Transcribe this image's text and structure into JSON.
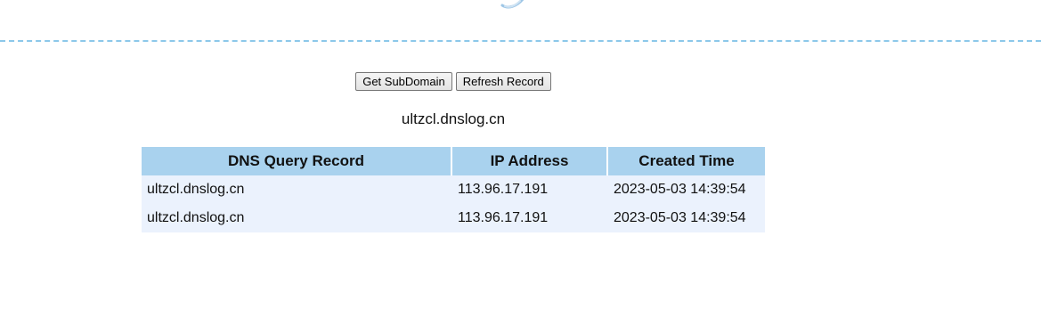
{
  "buttons": {
    "get_subdomain": "Get SubDomain",
    "refresh_record": "Refresh Record"
  },
  "subdomain": "ultzcl.dnslog.cn",
  "table": {
    "headers": [
      "DNS Query Record",
      "IP Address",
      "Created Time"
    ],
    "rows": [
      [
        "ultzcl.dnslog.cn",
        "113.96.17.191",
        "2023-05-03 14:39:54"
      ],
      [
        "ultzcl.dnslog.cn",
        "113.96.17.191",
        "2023-05-03 14:39:54"
      ]
    ]
  },
  "colors": {
    "divider": "#8cc8ea",
    "header_bg": "#a9d2ee",
    "row_bg": "#ebf2fd"
  },
  "icons": {
    "logo_fragment": "logo-swoosh-icon"
  }
}
